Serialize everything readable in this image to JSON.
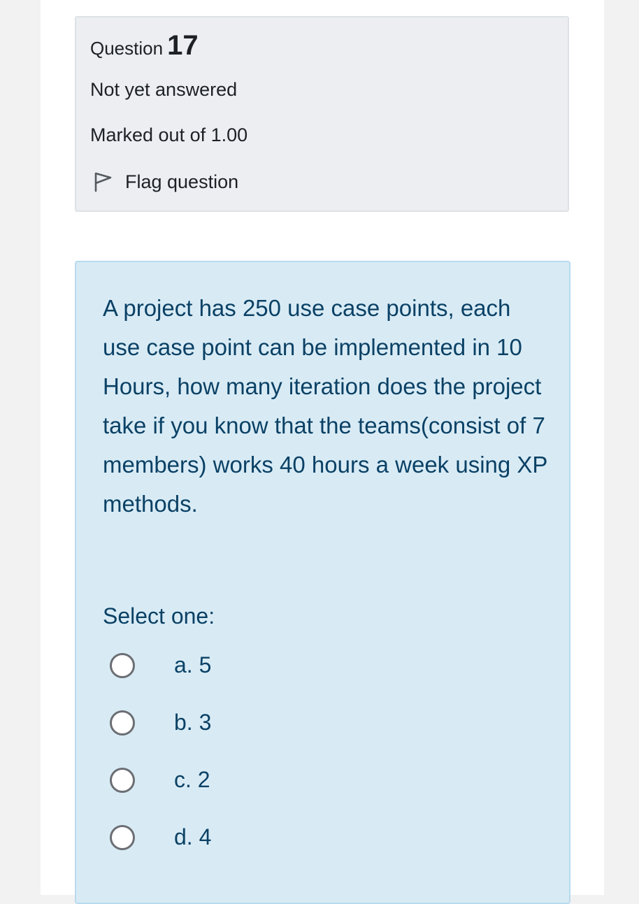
{
  "question": {
    "label": "Question",
    "number": "17",
    "state": "Not yet answered",
    "grade": "Marked out of 1.00",
    "flag_label": "Flag question"
  },
  "formulation": {
    "text": "A project has 250 use case points, each use case point can be implemented in 10 Hours, how many iteration does the project take if you know that the teams(consist of 7 members) works 40 hours a week using XP methods.",
    "prompt": "Select one:",
    "options": [
      {
        "label": "a. 5",
        "selected": false
      },
      {
        "label": "b. 3",
        "selected": false
      },
      {
        "label": "c. 2",
        "selected": false
      },
      {
        "label": "d. 4",
        "selected": false
      }
    ]
  },
  "colors": {
    "info_background": "#eceef1",
    "formulation_background": "#d8ebf5",
    "formulation_text": "#0b4165"
  },
  "icons": {
    "flag": "flag-icon"
  }
}
